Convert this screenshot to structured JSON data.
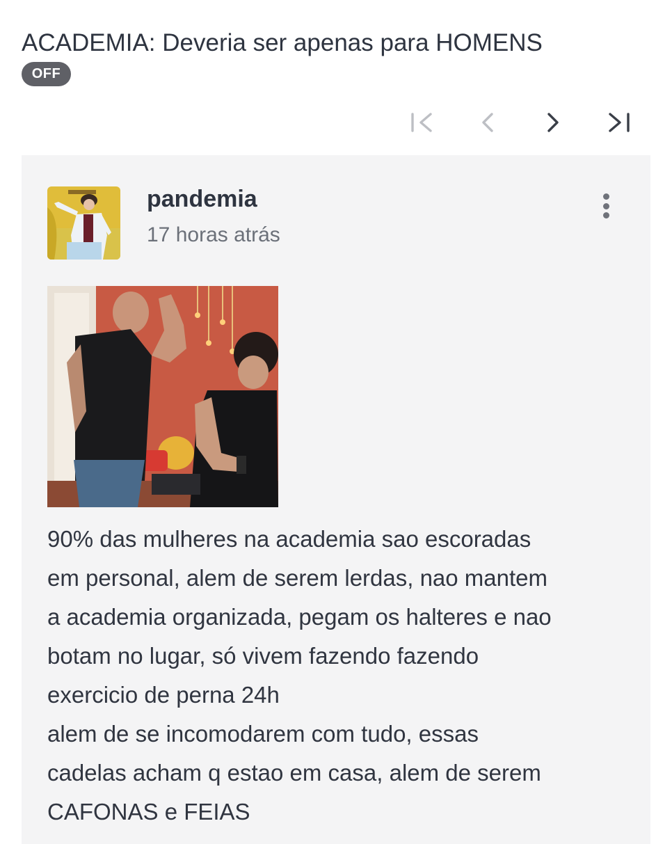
{
  "thread": {
    "title": "ACADEMIA: Deveria ser apenas para HOMENS",
    "tag": "OFF"
  },
  "pagination": {
    "first": "first-page-icon",
    "prev": "chevron-left-icon",
    "next": "chevron-right-icon",
    "last": "last-page-icon"
  },
  "post": {
    "author": "pandemia",
    "time": "17 horas atrás",
    "body": "90% das mulheres na academia sao escoradas\nem personal, alem de serem lerdas, nao mantem\na academia organizada, pegam os halteres e nao\nbotam no lugar, só vivem fazendo fazendo\nexercicio de perna 24h\nalem de se incomodarem com tudo, essas\ncadelas acham q estao em casa, alem de serem\nCAFONAS e FEIAS"
  },
  "colors": {
    "card_bg": "#f4f4f5",
    "badge_bg": "#5f6066",
    "text": "#2e3440",
    "muted": "#6b7079"
  }
}
